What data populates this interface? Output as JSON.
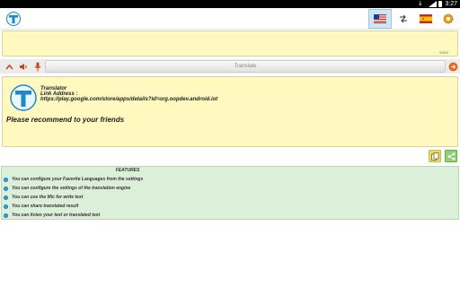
{
  "status_bar": {
    "time": "3:27"
  },
  "toolbar": {
    "source_language_icon": "us-flag-icon",
    "swap_icon": "swap-arrows-icon",
    "target_language_icon": "spain-flag-icon",
    "settings_icon": "gear-icon"
  },
  "input": {
    "text": "",
    "counter": "0/500"
  },
  "actionbar": {
    "translate_label": "Translate"
  },
  "output": {
    "app_name": "Translator",
    "link_label": "Link Address :",
    "link_url": "https://play.google.com/store/apps/details?id=org.oopdev.android.iot",
    "recommend_text": "Please recommend to your friends"
  },
  "features": {
    "title": "FEATURES",
    "items": [
      "You can configure your Favorite Languages from the settings",
      "You can configure the settings of the translation engine",
      "You can use the Mic for write text",
      "You can share translated result",
      "You can listen your text or translated text"
    ]
  },
  "colors": {
    "panel_bg": "#fff8bf",
    "features_bg": "#dcefd8",
    "accent_blue": "#3aa0d8",
    "copy_btn": "#e6dc6a",
    "share_btn": "#8fd070"
  }
}
